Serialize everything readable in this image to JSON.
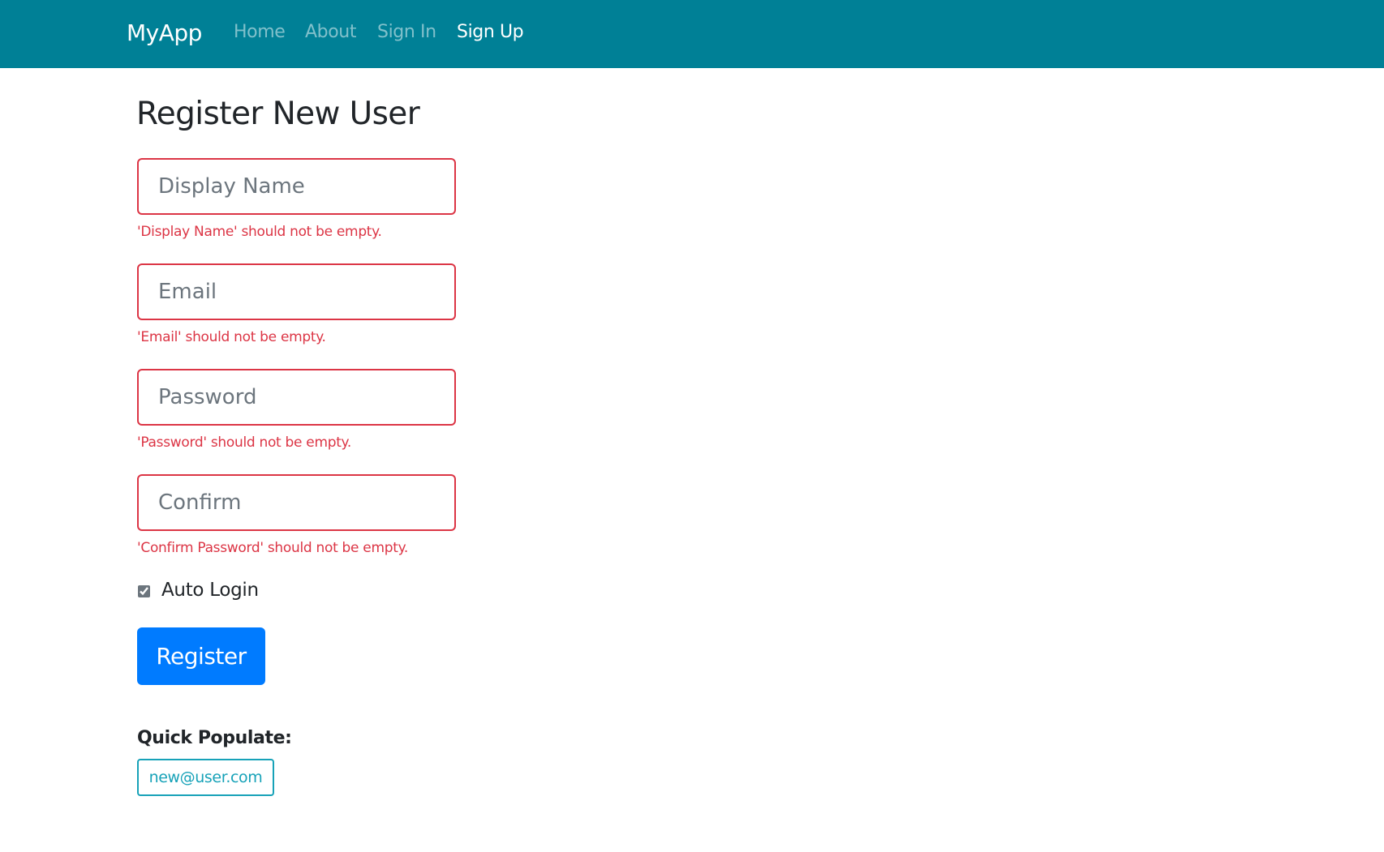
{
  "navbar": {
    "brand": "MyApp",
    "links": [
      {
        "label": "Home",
        "active": false
      },
      {
        "label": "About",
        "active": false
      },
      {
        "label": "Sign In",
        "active": false
      },
      {
        "label": "Sign Up",
        "active": true
      }
    ],
    "background_color": "#008096"
  },
  "page": {
    "title": "Register New User"
  },
  "form": {
    "fields": [
      {
        "placeholder": "Display Name",
        "value": "",
        "error": "'Display Name' should not be empty."
      },
      {
        "placeholder": "Email",
        "value": "",
        "error": "'Email' should not be empty."
      },
      {
        "placeholder": "Password",
        "value": "",
        "error": "'Password' should not be empty."
      },
      {
        "placeholder": "Confirm",
        "value": "",
        "error": "'Confirm Password' should not be empty."
      }
    ],
    "auto_login": {
      "label": "Auto Login",
      "checked": true
    },
    "submit_label": "Register",
    "error_color": "#dc3545",
    "primary_color": "#007bff"
  },
  "quick_populate": {
    "label": "Quick Populate:",
    "options": [
      "new@user.com"
    ],
    "accent_color": "#17a2b8"
  }
}
